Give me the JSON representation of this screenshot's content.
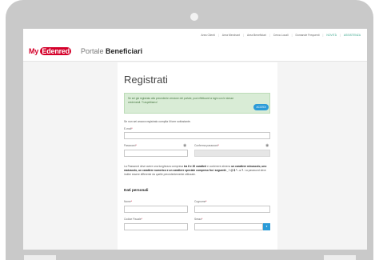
{
  "topnav": {
    "items": [
      "Area Clienti",
      "Area Merchant",
      "Area Beneficiari",
      "Cerca Locali",
      "Domande Frequenti"
    ],
    "highlight": [
      "NOVITÀ",
      "ASSISTENZA"
    ]
  },
  "header": {
    "logo_my": "My",
    "logo_edenred": "Edenred",
    "portal_light": "Portale",
    "portal_bold": "Beneficiari"
  },
  "form": {
    "title": "Registrati",
    "info_text": "Se sei già registrato alla precedente versione del portale, puoi effettuare la login con le stesse credenziali. Ti aspettiamo!",
    "accedi_label": "ACCEDI",
    "lead": "Se non sei ancora registrato compila il form sottostante.",
    "email_label": "E-mail",
    "password_label": "Password",
    "confirm_password_label": "Conferma password",
    "required_mark": "*",
    "eye_glyph": "◉",
    "pwd_note_1": "La Password deve avere una lunghezza compresa ",
    "pwd_note_bold_1": "tra 8 e 20 caratteri",
    "pwd_note_2": " e contenere almeno ",
    "pwd_note_bold_2": "un carattere minuscolo, uno maiuscolo, un carattere numerico e un carattere speciale compreso fra i seguenti:_ ! @ $ * - = ?",
    "pwd_note_3": ". La password deve inoltre essere differente da quelle precedentemente utilizzate.",
    "section_title": "Dati personali",
    "nome_label": "Nome",
    "cognome_label": "Cognome",
    "cf_label": "Codice Fiscale",
    "sesso_label": "Sesso",
    "select_glyph": "▾"
  },
  "colors": {
    "brand_red": "#d4002a",
    "accent_blue": "#2b9bd8",
    "accent_green": "#3aa68c",
    "info_green_bg": "#d9ecd6"
  }
}
